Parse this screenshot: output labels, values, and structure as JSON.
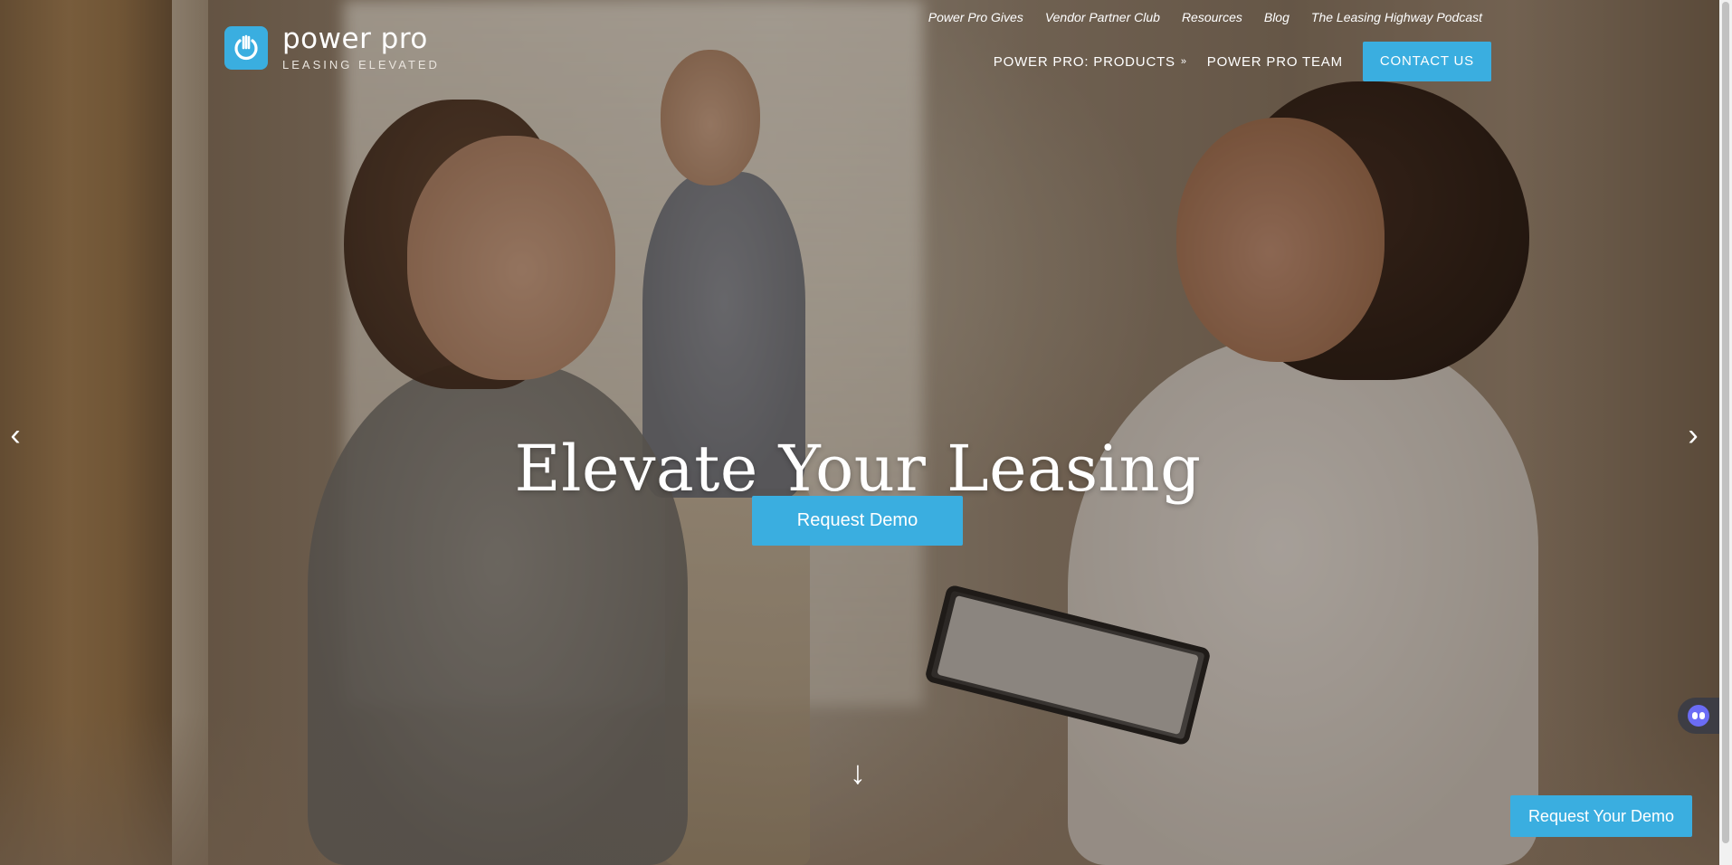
{
  "brand": {
    "name": "power pro",
    "tagline": "LEASING ELEVATED",
    "accent_color": "#3aaee0",
    "logo_icon": "power-icon"
  },
  "top_links": [
    {
      "label": "Power Pro Gives"
    },
    {
      "label": "Vendor Partner Club"
    },
    {
      "label": "Resources"
    },
    {
      "label": "Blog"
    },
    {
      "label": "The Leasing Highway Podcast"
    }
  ],
  "main_nav": {
    "products": {
      "label": "POWER PRO: PRODUCTS",
      "icon": "double-chevron-down-icon"
    },
    "team": {
      "label": "POWER PRO TEAM"
    },
    "contact": {
      "label": "CONTACT US"
    }
  },
  "hero": {
    "headline": "Elevate Your Leasing",
    "cta_label": "Request Demo",
    "prev_icon": "‹",
    "next_icon": "›",
    "scroll_icon": "↓"
  },
  "floating": {
    "request_demo_label": "Request Your Demo",
    "chat_icon": "chat-bot-icon"
  }
}
